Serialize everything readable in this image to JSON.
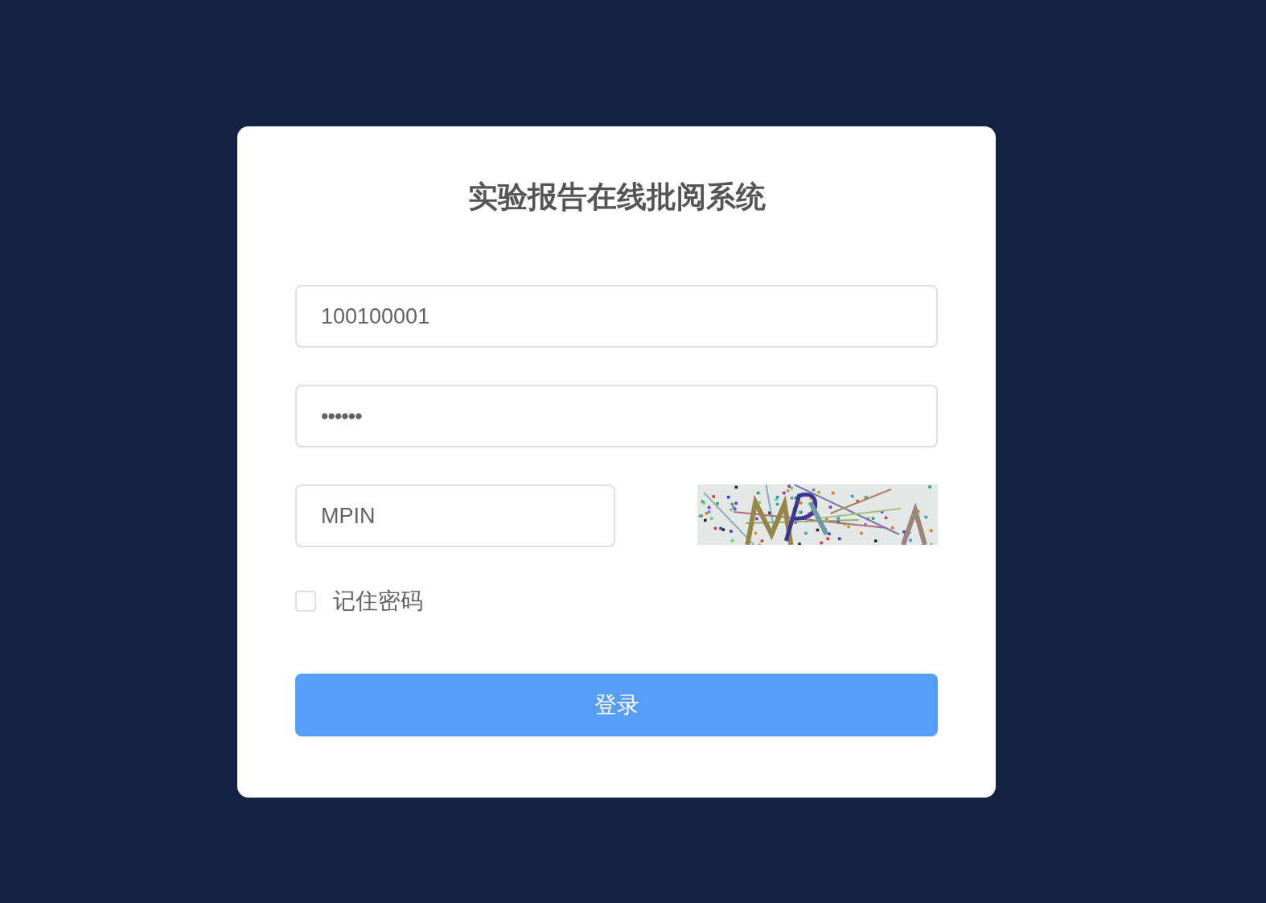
{
  "login_card": {
    "title": "实验报告在线批阅系统",
    "username": {
      "value": "100100001"
    },
    "password": {
      "value": "••••••"
    },
    "captcha": {
      "value": "MPIN"
    },
    "remember_password": {
      "label": "记住密码",
      "checked": false
    },
    "login_button": {
      "label": "登录"
    }
  }
}
